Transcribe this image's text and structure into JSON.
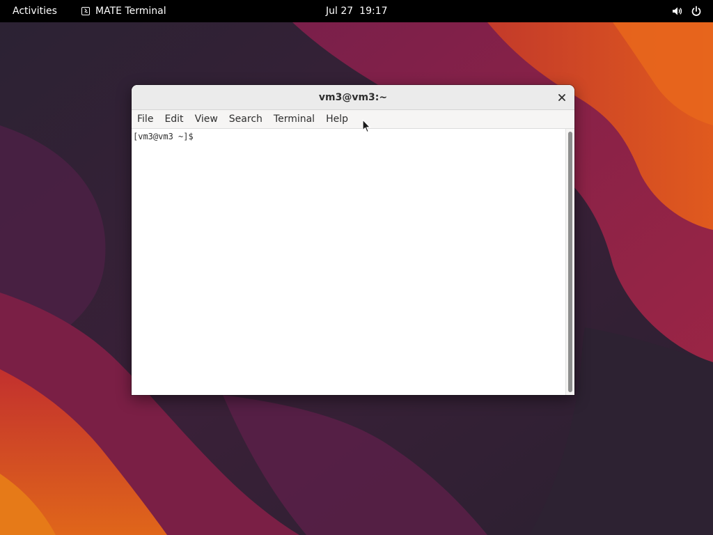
{
  "colors": {
    "topbar_bg": "#000000",
    "topbar_text": "#ffffff",
    "window_bg": "#ffffff",
    "titlebar_bg": "#ebebeb",
    "menubar_bg": "#f6f5f4",
    "text": "#2e2e2e",
    "wallpaper_dark": "#2a1f33",
    "wallpaper_magenta": "#8a2050",
    "wallpaper_orange": "#d94a1e"
  },
  "topbar": {
    "activities_label": "Activities",
    "app_icon": "terminal-icon",
    "app_name": "MATE Terminal",
    "date": "Jul 27",
    "time": "19:17",
    "volume_icon": "volume-icon",
    "power_icon": "power-icon"
  },
  "window": {
    "title": "vm3@vm3:~",
    "close_icon": "close-icon",
    "menu": [
      {
        "label": "File"
      },
      {
        "label": "Edit"
      },
      {
        "label": "View"
      },
      {
        "label": "Search"
      },
      {
        "label": "Terminal"
      },
      {
        "label": "Help"
      }
    ],
    "terminal": {
      "prompt": "[vm3@vm3 ~]$ "
    }
  }
}
